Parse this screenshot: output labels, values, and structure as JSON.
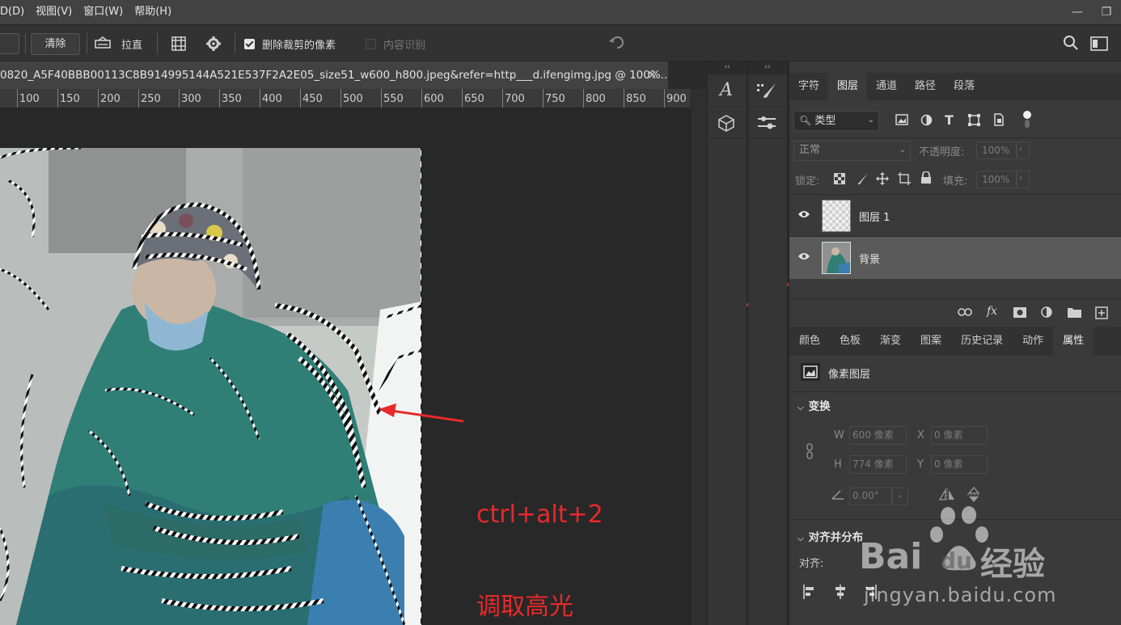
{
  "menu": {
    "items": [
      "D(D)",
      "视图(V)",
      "窗口(W)",
      "帮助(H)"
    ],
    "window_controls": [
      "—",
      "❐"
    ]
  },
  "options_bar": {
    "clear_label": "清除",
    "straighten_label": "拉直",
    "delete_cropped_label": "删除裁剪的像素",
    "delete_cropped_checked": true,
    "content_aware_label": "内容识别",
    "content_aware_checked": false
  },
  "document": {
    "tab_title": "0820_A5F40BBB00113C8B914995144A521E537F2A2E05_size51_w600_h800.jpeg&refer=http___d.ifengimg.jpg @ 100%...",
    "close_glyph": "✕",
    "ruler_ticks": [
      "100",
      "150",
      "200",
      "250",
      "300",
      "350",
      "400",
      "450",
      "500",
      "550",
      "600",
      "650",
      "700",
      "750",
      "800",
      "850",
      "900"
    ]
  },
  "annotation": {
    "line1": "ctrl+alt+2",
    "line2": "调取高光",
    "color": "#e8292b"
  },
  "panel_top": {
    "tabs": [
      "字符",
      "图层",
      "通道",
      "路径",
      "段落"
    ],
    "active_tab": "图层",
    "filter_kind_label": "类型",
    "blend_mode": "正常",
    "opacity_label": "不透明度:",
    "opacity_value": "100%",
    "lock_label": "锁定:",
    "fill_label": "填充:",
    "fill_value": "100%",
    "layers": [
      {
        "name": "图层 1",
        "selected": false
      },
      {
        "name": "背景",
        "selected": true
      }
    ],
    "footer_fx": "fx"
  },
  "panel_bottom": {
    "tabs": [
      "颜色",
      "色板",
      "渐变",
      "图案",
      "历史记录",
      "动作",
      "属性"
    ],
    "active_tab": "属性",
    "layer_kind": "像素图层",
    "transform_header": "变换",
    "w_label": "W",
    "w_value": "600 像素",
    "x_label": "X",
    "x_value": "0 像素",
    "h_label": "H",
    "h_value": "774 像素",
    "y_label": "Y",
    "y_value": "0 像素",
    "angle_value": "0.00°",
    "align_header": "对齐并分布",
    "align_label": "对齐:"
  },
  "watermark": {
    "brand": "Bai",
    "brand2": "du",
    "suffix": "经验",
    "url": "jingyan.baidu.com"
  }
}
